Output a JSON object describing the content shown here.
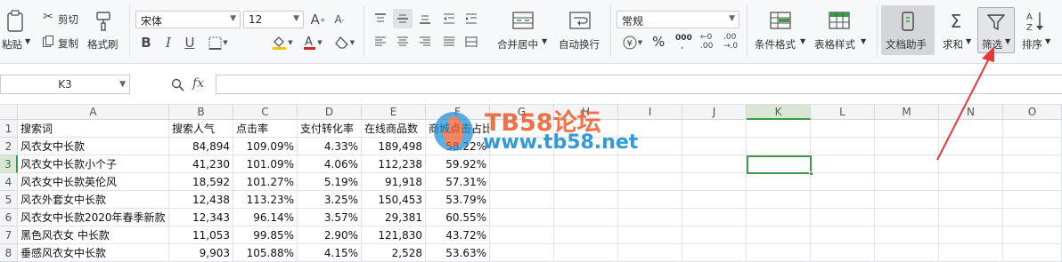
{
  "ribbon": {
    "paste": "粘贴",
    "cut": "剪切",
    "copy": "复制",
    "format_painter": "格式刷",
    "font_name": "宋体",
    "font_size": "12",
    "merge_center": "合并居中",
    "wrap_text": "自动换行",
    "number_format": "常规",
    "conditional_format": "条件格式",
    "table_style": "表格样式",
    "doc_helper": "文档助手",
    "sum": "求和",
    "filter": "筛选",
    "sort": "排序",
    "percent": "%",
    "thousands": "000",
    "inc_decimal_top": "←0",
    "inc_decimal_bottom": ".00",
    "dec_decimal_top": ".00",
    "dec_decimal_bottom": "→.0"
  },
  "formula_bar": {
    "name_box": "K3",
    "fx": "fx",
    "value": ""
  },
  "columns": [
    "A",
    "B",
    "C",
    "D",
    "E",
    "F",
    "G",
    "H",
    "I",
    "J",
    "K",
    "L",
    "M",
    "N",
    "O"
  ],
  "rows": [
    "1",
    "2",
    "3",
    "4",
    "5",
    "6",
    "7",
    "8"
  ],
  "table": [
    [
      "搜索词",
      "搜索人气",
      "点击率",
      "支付转化率",
      "在线商品数",
      "商城点击占比"
    ],
    [
      "风衣女中长款",
      "84,894",
      "109.09%",
      "4.33%",
      "189,498",
      "58.22%"
    ],
    [
      "风衣女中长款小个子",
      "41,230",
      "101.09%",
      "4.06%",
      "112,238",
      "59.92%"
    ],
    [
      "风衣女中长款英伦风",
      "18,592",
      "101.27%",
      "5.19%",
      "91,918",
      "57.31%"
    ],
    [
      "风衣外套女中长款",
      "12,438",
      "113.23%",
      "3.25%",
      "150,453",
      "53.79%"
    ],
    [
      "风衣女中长款2020年春季新款",
      "12,343",
      "96.14%",
      "3.57%",
      "29,381",
      "60.55%"
    ],
    [
      "黑色风衣女 中长款",
      "11,053",
      "99.85%",
      "2.90%",
      "121,830",
      "43.72%"
    ],
    [
      "垂感风衣女中长款",
      "9,903",
      "105.88%",
      "4.15%",
      "2,528",
      "53.63%"
    ]
  ],
  "watermark": {
    "title": "TB58论坛",
    "url": "www.tb58.net"
  },
  "colors": {
    "accent_green": "#3c9a4a",
    "arrow_red": "#e83a3a",
    "watermark_orange": "#f05a28",
    "watermark_blue": "#1e8fd6"
  }
}
